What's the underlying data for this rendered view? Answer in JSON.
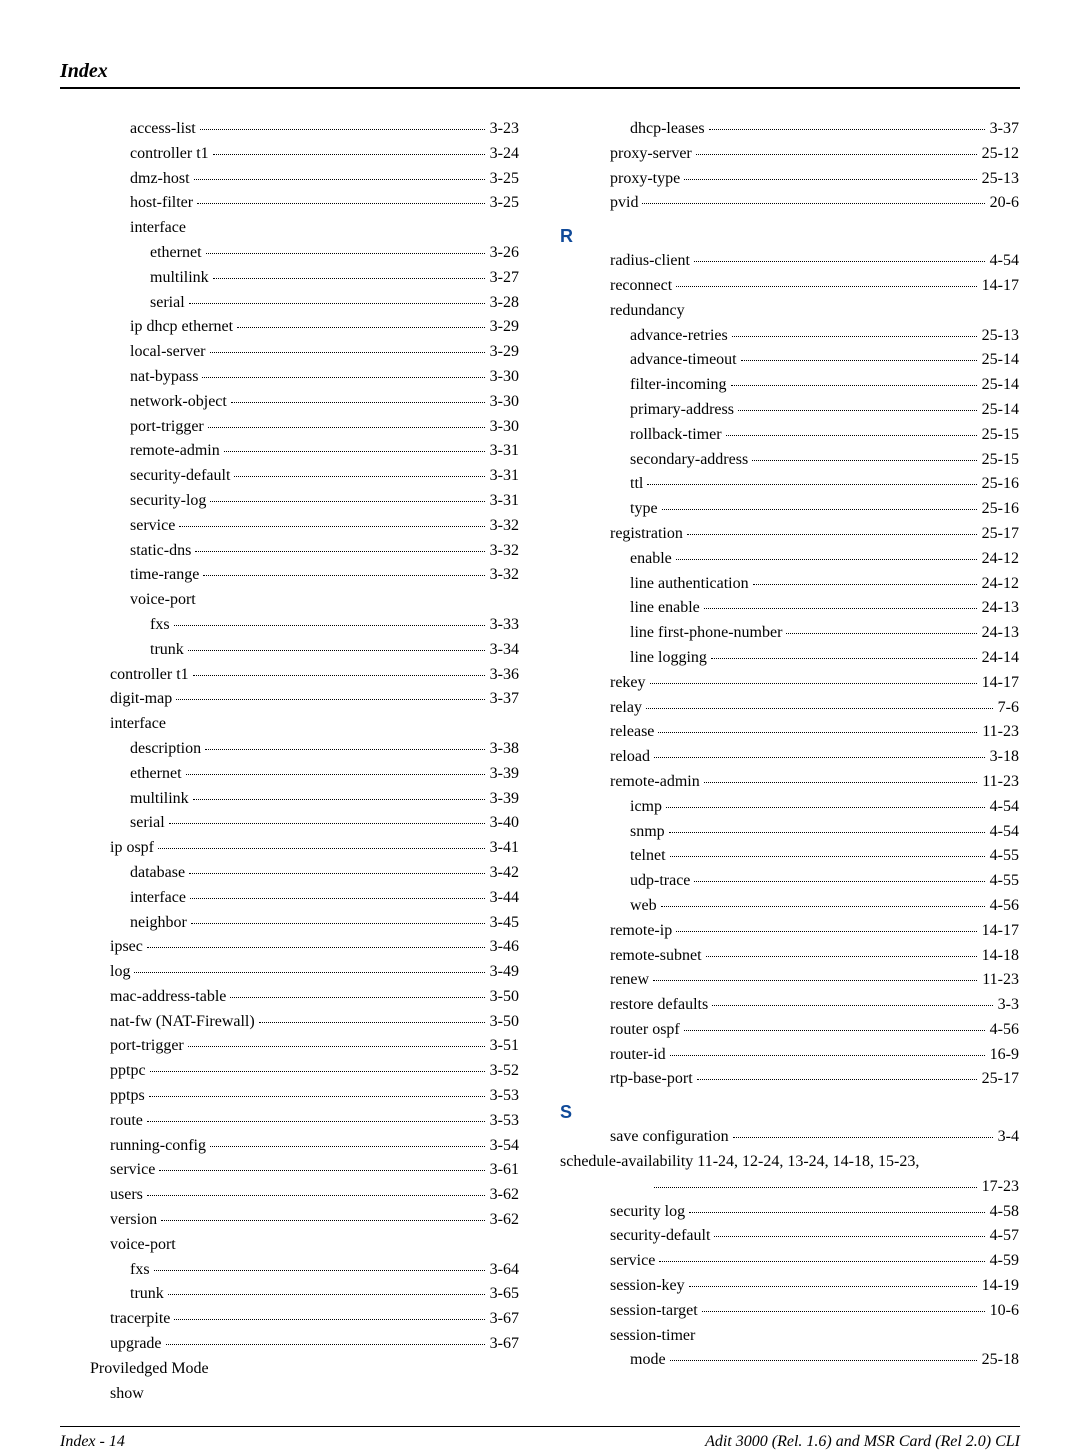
{
  "header": {
    "title": "Index"
  },
  "footer": {
    "left": "Index - 14",
    "right": "Adit 3000 (Rel. 1.6)  and MSR Card (Rel 2.0) CLI"
  },
  "left_col": [
    {
      "type": "entry",
      "indent": 1,
      "label": "access-list",
      "page": "3-23"
    },
    {
      "type": "entry",
      "indent": 1,
      "label": "controller t1",
      "page": "3-24"
    },
    {
      "type": "entry",
      "indent": 1,
      "label": "dmz-host",
      "page": "3-25"
    },
    {
      "type": "entry",
      "indent": 1,
      "label": "host-filter",
      "page": "3-25"
    },
    {
      "type": "group",
      "indent": 1,
      "label": "interface"
    },
    {
      "type": "entry",
      "indent": 2,
      "label": "ethernet",
      "page": "3-26"
    },
    {
      "type": "entry",
      "indent": 2,
      "label": "multilink",
      "page": "3-27"
    },
    {
      "type": "entry",
      "indent": 2,
      "label": "serial",
      "page": "3-28"
    },
    {
      "type": "entry",
      "indent": 1,
      "label": "ip dhcp ethernet",
      "page": "3-29"
    },
    {
      "type": "entry",
      "indent": 1,
      "label": "local-server",
      "page": "3-29"
    },
    {
      "type": "entry",
      "indent": 1,
      "label": "nat-bypass",
      "page": "3-30"
    },
    {
      "type": "entry",
      "indent": 1,
      "label": "network-object",
      "page": "3-30"
    },
    {
      "type": "entry",
      "indent": 1,
      "label": "port-trigger",
      "page": "3-30"
    },
    {
      "type": "entry",
      "indent": 1,
      "label": "remote-admin",
      "page": "3-31"
    },
    {
      "type": "entry",
      "indent": 1,
      "label": "security-default",
      "page": "3-31"
    },
    {
      "type": "entry",
      "indent": 1,
      "label": "security-log",
      "page": "3-31"
    },
    {
      "type": "entry",
      "indent": 1,
      "label": "service",
      "page": "3-32"
    },
    {
      "type": "entry",
      "indent": 1,
      "label": "static-dns",
      "page": "3-32"
    },
    {
      "type": "entry",
      "indent": 1,
      "label": "time-range",
      "page": "3-32"
    },
    {
      "type": "group",
      "indent": 1,
      "label": "voice-port"
    },
    {
      "type": "entry",
      "indent": 2,
      "label": "fxs",
      "page": "3-33"
    },
    {
      "type": "entry",
      "indent": 2,
      "label": "trunk",
      "page": "3-34"
    },
    {
      "type": "entry",
      "indent": 0,
      "label": "controller t1",
      "page": "3-36"
    },
    {
      "type": "entry",
      "indent": 0,
      "label": "digit-map",
      "page": "3-37"
    },
    {
      "type": "group",
      "indent": 0,
      "label": "interface"
    },
    {
      "type": "entry",
      "indent": 1,
      "label": "description",
      "page": "3-38"
    },
    {
      "type": "entry",
      "indent": 1,
      "label": "ethernet",
      "page": "3-39"
    },
    {
      "type": "entry",
      "indent": 1,
      "label": "multilink",
      "page": "3-39"
    },
    {
      "type": "entry",
      "indent": 1,
      "label": "serial",
      "page": "3-40"
    },
    {
      "type": "entry",
      "indent": 0,
      "label": "ip ospf",
      "page": "3-41"
    },
    {
      "type": "entry",
      "indent": 1,
      "label": "database",
      "page": "3-42"
    },
    {
      "type": "entry",
      "indent": 1,
      "label": "interface",
      "page": "3-44"
    },
    {
      "type": "entry",
      "indent": 1,
      "label": "neighbor",
      "page": "3-45"
    },
    {
      "type": "entry",
      "indent": 0,
      "label": "ipsec",
      "page": "3-46"
    },
    {
      "type": "entry",
      "indent": 0,
      "label": "log",
      "page": "3-49"
    },
    {
      "type": "entry",
      "indent": 0,
      "label": "mac-address-table",
      "page": "3-50"
    },
    {
      "type": "entry",
      "indent": 0,
      "label": "nat-fw (NAT-Firewall)",
      "page": "3-50"
    },
    {
      "type": "entry",
      "indent": 0,
      "label": "port-trigger",
      "page": "3-51"
    },
    {
      "type": "entry",
      "indent": 0,
      "label": "pptpc",
      "page": "3-52"
    },
    {
      "type": "entry",
      "indent": 0,
      "label": "pptps",
      "page": "3-53"
    },
    {
      "type": "entry",
      "indent": 0,
      "label": "route",
      "page": "3-53"
    },
    {
      "type": "entry",
      "indent": 0,
      "label": "running-config",
      "page": "3-54"
    },
    {
      "type": "entry",
      "indent": 0,
      "label": "service",
      "page": "3-61"
    },
    {
      "type": "entry",
      "indent": 0,
      "label": "users",
      "page": "3-62"
    },
    {
      "type": "entry",
      "indent": 0,
      "label": "version",
      "page": "3-62"
    },
    {
      "type": "group",
      "indent": 0,
      "label": "voice-port"
    },
    {
      "type": "entry",
      "indent": 1,
      "label": "fxs",
      "page": "3-64"
    },
    {
      "type": "entry",
      "indent": 1,
      "label": "trunk",
      "page": "3-65"
    },
    {
      "type": "entry",
      "indent": 0,
      "label": "tracerpite",
      "page": "3-67"
    },
    {
      "type": "entry",
      "indent": 0,
      "label": "upgrade",
      "page": "3-67"
    },
    {
      "type": "group",
      "indent": -1,
      "label": "Proviledged Mode"
    },
    {
      "type": "group",
      "indent": 0,
      "label": "show"
    }
  ],
  "right_col": [
    {
      "type": "entry",
      "indent": 1,
      "label": "dhcp-leases",
      "page": "3-37"
    },
    {
      "type": "entry",
      "indent": 0,
      "label": "proxy-server",
      "page": "25-12"
    },
    {
      "type": "entry",
      "indent": 0,
      "label": "proxy-type",
      "page": "25-13"
    },
    {
      "type": "entry",
      "indent": 0,
      "label": "pvid",
      "page": "20-6"
    },
    {
      "type": "letter",
      "label": "R"
    },
    {
      "type": "entry",
      "indent": 0,
      "label": "radius-client",
      "page": "4-54"
    },
    {
      "type": "entry",
      "indent": 0,
      "label": "reconnect",
      "page": "14-17"
    },
    {
      "type": "group",
      "indent": 0,
      "label": "redundancy"
    },
    {
      "type": "entry",
      "indent": 1,
      "label": "advance-retries",
      "page": "25-13"
    },
    {
      "type": "entry",
      "indent": 1,
      "label": "advance-timeout",
      "page": "25-14"
    },
    {
      "type": "entry",
      "indent": 1,
      "label": "filter-incoming",
      "page": "25-14"
    },
    {
      "type": "entry",
      "indent": 1,
      "label": "primary-address",
      "page": "25-14"
    },
    {
      "type": "entry",
      "indent": 1,
      "label": "rollback-timer",
      "page": "25-15"
    },
    {
      "type": "entry",
      "indent": 1,
      "label": "secondary-address",
      "page": "25-15"
    },
    {
      "type": "entry",
      "indent": 1,
      "label": "ttl",
      "page": "25-16"
    },
    {
      "type": "entry",
      "indent": 1,
      "label": "type",
      "page": "25-16"
    },
    {
      "type": "entry",
      "indent": 0,
      "label": "registration",
      "page": "25-17"
    },
    {
      "type": "entry",
      "indent": 1,
      "label": "enable",
      "page": "24-12"
    },
    {
      "type": "entry",
      "indent": 1,
      "label": "line authentication",
      "page": "24-12"
    },
    {
      "type": "entry",
      "indent": 1,
      "label": "line enable",
      "page": "24-13"
    },
    {
      "type": "entry",
      "indent": 1,
      "label": "line first-phone-number",
      "page": "24-13"
    },
    {
      "type": "entry",
      "indent": 1,
      "label": "line logging",
      "page": "24-14"
    },
    {
      "type": "entry",
      "indent": 0,
      "label": "rekey",
      "page": "14-17"
    },
    {
      "type": "entry",
      "indent": 0,
      "label": "relay",
      "page": "7-6"
    },
    {
      "type": "entry",
      "indent": 0,
      "label": "release",
      "page": "11-23"
    },
    {
      "type": "entry",
      "indent": 0,
      "label": "reload",
      "page": "3-18"
    },
    {
      "type": "entry",
      "indent": 0,
      "label": "remote-admin",
      "page": "11-23"
    },
    {
      "type": "entry",
      "indent": 1,
      "label": "icmp",
      "page": "4-54"
    },
    {
      "type": "entry",
      "indent": 1,
      "label": "snmp",
      "page": "4-54"
    },
    {
      "type": "entry",
      "indent": 1,
      "label": "telnet",
      "page": "4-55"
    },
    {
      "type": "entry",
      "indent": 1,
      "label": "udp-trace",
      "page": "4-55"
    },
    {
      "type": "entry",
      "indent": 1,
      "label": "web",
      "page": "4-56"
    },
    {
      "type": "entry",
      "indent": 0,
      "label": "remote-ip",
      "page": "14-17"
    },
    {
      "type": "entry",
      "indent": 0,
      "label": "remote-subnet",
      "page": "14-18"
    },
    {
      "type": "entry",
      "indent": 0,
      "label": "renew",
      "page": "11-23"
    },
    {
      "type": "entry",
      "indent": 0,
      "label": "restore defaults",
      "page": "3-3"
    },
    {
      "type": "entry",
      "indent": 0,
      "label": "router ospf",
      "page": "4-56"
    },
    {
      "type": "entry",
      "indent": 0,
      "label": "router-id",
      "page": "16-9"
    },
    {
      "type": "entry",
      "indent": 0,
      "label": "rtp-base-port",
      "page": "25-17"
    },
    {
      "type": "letter",
      "label": "S"
    },
    {
      "type": "entry",
      "indent": 0,
      "label": "save configuration",
      "page": "3-4"
    },
    {
      "type": "schedule",
      "line1": "schedule-availability  11-24, 12-24, 13-24, 14-18, 15-23,",
      "page": "17-23"
    },
    {
      "type": "entry",
      "indent": 0,
      "label": "security log",
      "page": "4-58"
    },
    {
      "type": "entry",
      "indent": 0,
      "label": "security-default",
      "page": "4-57"
    },
    {
      "type": "entry",
      "indent": 0,
      "label": "service",
      "page": "4-59"
    },
    {
      "type": "entry",
      "indent": 0,
      "label": "session-key",
      "page": "14-19"
    },
    {
      "type": "entry",
      "indent": 0,
      "label": "session-target",
      "page": "10-6"
    },
    {
      "type": "group",
      "indent": 0,
      "label": "session-timer"
    },
    {
      "type": "entry",
      "indent": 1,
      "label": "mode",
      "page": "25-18"
    }
  ]
}
